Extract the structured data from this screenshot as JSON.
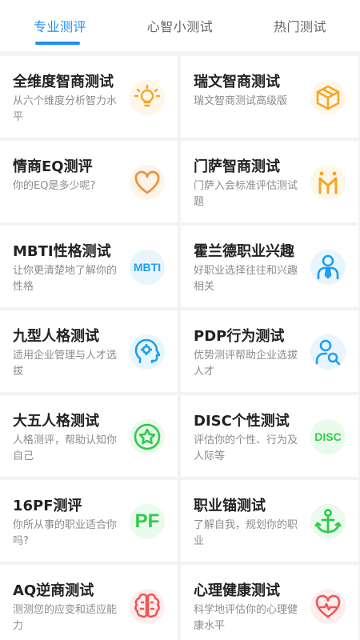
{
  "tabs": [
    {
      "label": "专业测评"
    },
    {
      "label": "心智小测试"
    },
    {
      "label": "热门测试"
    }
  ],
  "cards": [
    {
      "title": "全维度智商测试",
      "desc": "从六个维度分析智力水平",
      "icon": "lightbulb-icon",
      "color": "#f5a623"
    },
    {
      "title": "瑞文智商测试",
      "desc": "瑞文智商测试高级版",
      "icon": "cube-icon",
      "color": "#f5a623"
    },
    {
      "title": "情商EQ测评",
      "desc": "你的EQ是多少呢?",
      "icon": "heart-icon",
      "color": "#f0923a"
    },
    {
      "title": "门萨智商测试",
      "desc": "门萨入会标准评估测试题",
      "icon": "mensa-icon",
      "color": "#f5a623"
    },
    {
      "title": "MBTI性格测试",
      "desc": "让你更清楚地了解你的性格",
      "icon": "mbti-icon",
      "color": "#1f9ff0",
      "icon_text": "MBTI"
    },
    {
      "title": "霍兰德职业兴趣",
      "desc": "好职业选择往往和兴趣相关",
      "icon": "person-tie-icon",
      "color": "#1f9ff0"
    },
    {
      "title": "九型人格测试",
      "desc": "适用企业管理与人才选拔",
      "icon": "head-gear-icon",
      "color": "#1f9ff0"
    },
    {
      "title": "PDP行为测试",
      "desc": "优势测评帮助企业选拔人才",
      "icon": "person-search-icon",
      "color": "#1f9ff0"
    },
    {
      "title": "大五人格测试",
      "desc": "人格测评，帮助认知你自己",
      "icon": "star-badge-icon",
      "color": "#2ecc4a"
    },
    {
      "title": "DISC个性测试",
      "desc": "评估你的个性、行为及人际等",
      "icon": "disc-icon",
      "color": "#2ecc4a",
      "icon_text": "DISC"
    },
    {
      "title": "16PF测评",
      "desc": "你所从事的职业适合你吗?",
      "icon": "pf-icon",
      "color": "#2ecc4a",
      "icon_text": "PF"
    },
    {
      "title": "职业锚测试",
      "desc": "了解自我，规划你的职业",
      "icon": "anchor-icon",
      "color": "#2ecc4a"
    },
    {
      "title": "AQ逆商测试",
      "desc": "测测您的应变和适应能力",
      "icon": "brain-icon",
      "color": "#ef5656"
    },
    {
      "title": "心理健康测试",
      "desc": "科学地评估你的心理健康水平",
      "icon": "heart-pulse-icon",
      "color": "#ef5656"
    }
  ]
}
